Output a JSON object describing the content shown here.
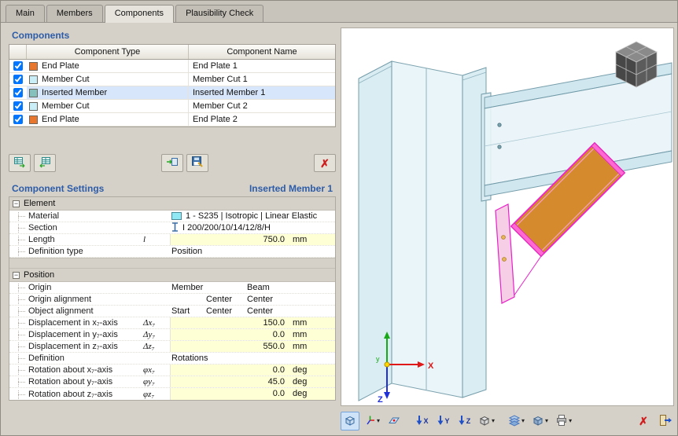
{
  "icons": {
    "dropdown": "▾",
    "close_x": "✗",
    "collapse": "−"
  },
  "colors": {
    "accent_blue": "#2d5ca8",
    "selection": "#d7e6fa",
    "steel_blue": "#cfe6ef",
    "plate_orange": "#d68a2e",
    "highlight_magenta": "#f020d0",
    "value_field_yellow": "#ffffd6"
  },
  "tabs": {
    "items": [
      {
        "label": "Main"
      },
      {
        "label": "Members"
      },
      {
        "label": "Components"
      },
      {
        "label": "Plausibility Check"
      }
    ],
    "active_index": 2
  },
  "components_panel": {
    "title": "Components",
    "columns": {
      "type": "Component Type",
      "name": "Component Name"
    },
    "rows": [
      {
        "checked": "checked",
        "swatch": "#e8762c",
        "type": "End Plate",
        "name": "End Plate 1"
      },
      {
        "checked": "checked",
        "swatch": "#c9eef8",
        "type": "Member Cut",
        "name": "Member Cut 1"
      },
      {
        "checked": "checked",
        "swatch": "#85c0bd",
        "type": "Inserted Member",
        "name": "Inserted Member 1"
      },
      {
        "checked": "checked",
        "swatch": "#c9eef8",
        "type": "Member Cut",
        "name": "Member Cut 2"
      },
      {
        "checked": "checked",
        "swatch": "#e8762c",
        "type": "End Plate",
        "name": "End Plate 2"
      }
    ]
  },
  "settings_panel": {
    "title": "Component Settings",
    "subtitle": "Inserted Member 1",
    "element_section": {
      "label": "Element",
      "material": {
        "label": "Material",
        "swatch": "#8fe8f4",
        "value": "1 - S235 | Isotropic | Linear Elastic"
      },
      "section": {
        "label": "Section",
        "value": "I 200/200/10/14/12/8/H"
      },
      "length": {
        "label": "Length",
        "symbol": "l",
        "value": "750.0",
        "unit": "mm"
      },
      "definition_type": {
        "label": "Definition type",
        "value": "Position"
      }
    },
    "position_section": {
      "label": "Position",
      "origin": {
        "label": "Origin",
        "col1": "Member",
        "col2": "",
        "col3": "Beam"
      },
      "origin_alignment": {
        "label": "Origin alignment",
        "col1": "",
        "col2": "Center",
        "col3": "Center"
      },
      "object_alignment": {
        "label": "Object alignment",
        "col1": "Start",
        "col2": "Center",
        "col3": "Center"
      },
      "disp_x": {
        "label": "Displacement in x₇-axis",
        "symbol": "Δx₇",
        "value": "150.0",
        "unit": "mm"
      },
      "disp_y": {
        "label": "Displacement in y₇-axis",
        "symbol": "Δy₇",
        "value": "0.0",
        "unit": "mm"
      },
      "disp_z": {
        "label": "Displacement in z₇-axis",
        "symbol": "Δz₇",
        "value": "550.0",
        "unit": "mm"
      },
      "definition": {
        "label": "Definition",
        "col1": "Rotations"
      },
      "rot_x": {
        "label": "Rotation about x₇-axis",
        "symbol": "φx₇",
        "value": "0.0",
        "unit": "deg"
      },
      "rot_y": {
        "label": "Rotation about y₇-axis",
        "symbol": "φy₇",
        "value": "45.0",
        "unit": "deg"
      },
      "rot_z": {
        "label": "Rotation about z₇-axis",
        "symbol": "φz₇",
        "value": "0.0",
        "unit": "deg"
      }
    }
  },
  "viewport": {
    "axis_labels": {
      "x": "X",
      "y": "y",
      "z": "Z"
    },
    "toolbar": {
      "view_x": "X",
      "view_y": "Y",
      "view_z": "Z"
    }
  }
}
